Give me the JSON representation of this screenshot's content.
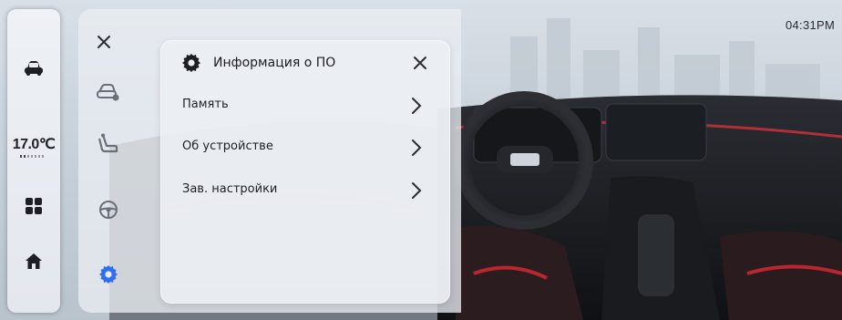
{
  "status_bar": {
    "time": "04:31PM"
  },
  "dock": {
    "items": [
      {
        "name": "car-icon",
        "active": false
      },
      {
        "name": "apps-grid-icon",
        "active": false
      },
      {
        "name": "home-icon",
        "active": false
      }
    ],
    "temperature": {
      "value": "17.0℃"
    }
  },
  "settings_sidebar": {
    "close_icon": "close-icon",
    "items": [
      {
        "name": "vehicle-settings-icon",
        "active": false
      },
      {
        "name": "seat-icon",
        "active": false
      },
      {
        "name": "steering-wheel-icon",
        "active": false
      },
      {
        "name": "gear-icon",
        "active": true
      }
    ],
    "accent_color": "#2f6ef0"
  },
  "dialog": {
    "title": "Информация о ПО",
    "icon": "gear-icon",
    "close_icon": "close-icon",
    "items": [
      {
        "label": "Память",
        "icon": "chevron-right-icon"
      },
      {
        "label": "Об устройстве",
        "icon": "chevron-right-icon"
      },
      {
        "label": "Зав. настройки",
        "icon": "chevron-right-icon"
      }
    ]
  }
}
